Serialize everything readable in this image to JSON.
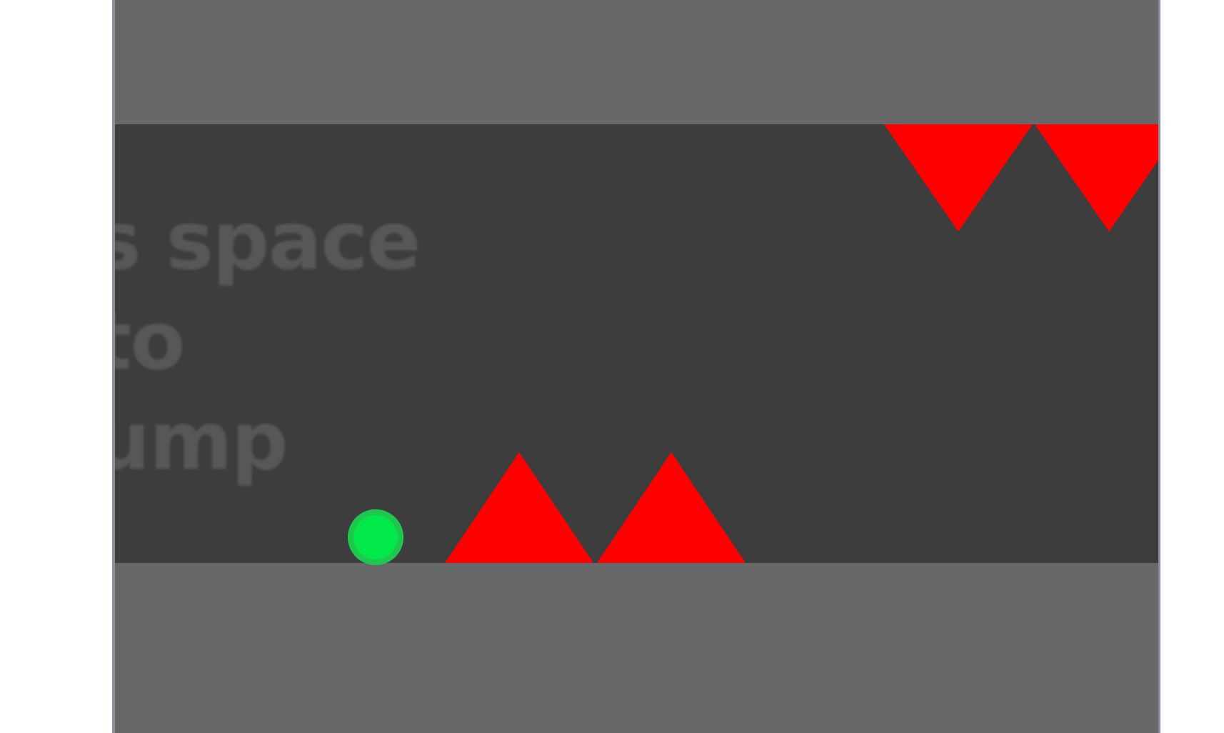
{
  "game": {
    "hint_text": "s space to\nump",
    "colors": {
      "frame": "#686868",
      "playfield": "#3d3d3d",
      "player": "#00e84a",
      "spike": "#ff0000",
      "hint_text": "#5a5a5a"
    }
  }
}
